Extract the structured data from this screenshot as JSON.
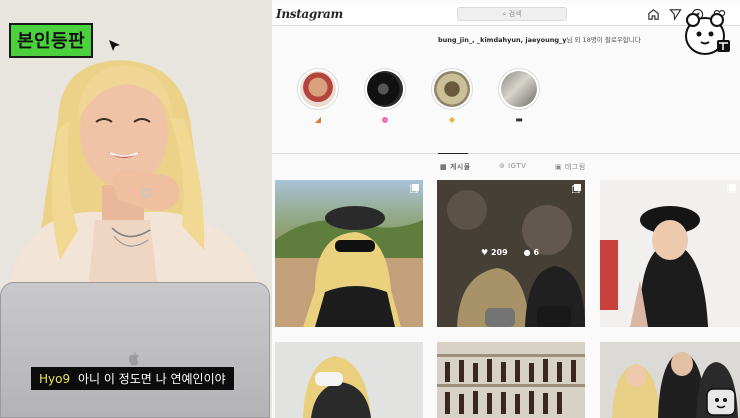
{
  "video": {
    "badge_text": "본인등판",
    "subtitle": {
      "speaker": "Hyo9",
      "text": "아니 이 정도면 나 연예인이야"
    }
  },
  "instagram": {
    "logo": "Instagram",
    "search_placeholder": "검색",
    "followed_by": {
      "names": "bung_jin_, _kimdahyun, jaeyoung_y",
      "suffix": "님 외 18명이 팔로우합니다"
    },
    "highlights": [
      {
        "name": "highlight-1",
        "label_emoji": "◢",
        "label_color": "#e07a2f"
      },
      {
        "name": "highlight-2",
        "label_emoji": "●",
        "label_color": "#e77ab0"
      },
      {
        "name": "highlight-3",
        "label_emoji": "◆",
        "label_color": "#f2b233"
      },
      {
        "name": "highlight-4",
        "label_emoji": "▬",
        "label_color": "#333333"
      }
    ],
    "tabs": [
      {
        "label": "게시물",
        "icon": "grid-icon",
        "active": true
      },
      {
        "label": "IGTV",
        "icon": "igtv-icon",
        "active": false
      },
      {
        "label": "태그됨",
        "icon": "tagged-icon",
        "active": false
      }
    ],
    "hovered_post": {
      "likes": "209",
      "comments": "6"
    },
    "nav_icons": [
      "home-icon",
      "direct-icon",
      "explore-icon",
      "heart-icon"
    ]
  },
  "colors": {
    "badge_green": "#4bd13d",
    "subtitle_speaker": "#e5e35a",
    "ig_background": "#fafafa"
  }
}
